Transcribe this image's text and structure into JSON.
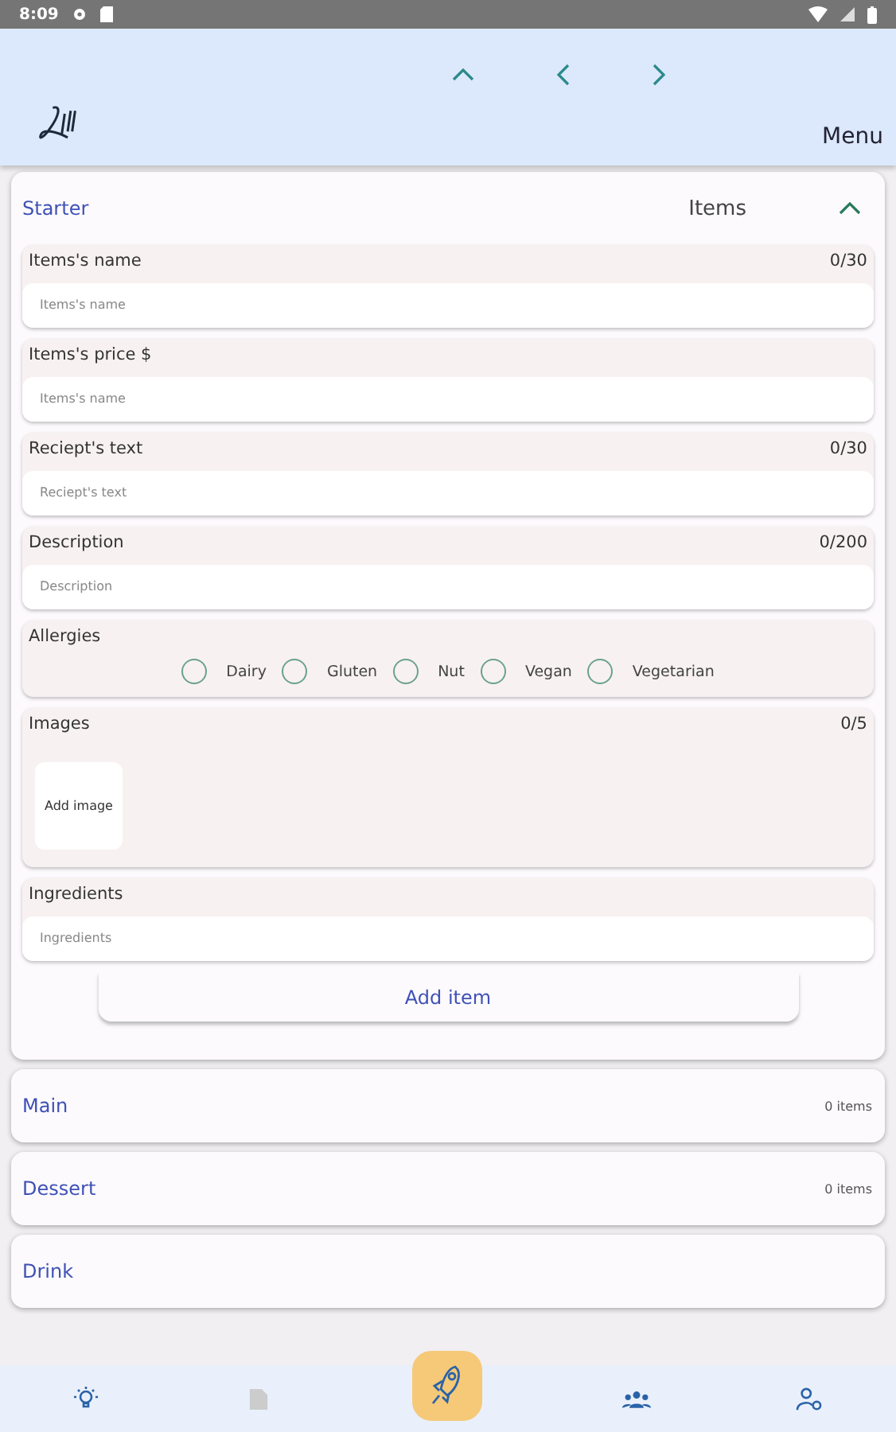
{
  "status_bar": {
    "time": "8:09"
  },
  "header": {
    "menu_label": "Menu"
  },
  "open_category": {
    "name": "Starter",
    "items_label": "Items",
    "expanded": true,
    "fields": [
      {
        "kind": "text",
        "label": "Items's name",
        "counter": "0/30",
        "placeholder": "Items's name"
      },
      {
        "kind": "text",
        "label": "Items's price $",
        "placeholder": "Items's name"
      },
      {
        "kind": "text",
        "label": "Reciept's text",
        "counter": "0/30",
        "placeholder": "Reciept's text"
      },
      {
        "kind": "text",
        "label": "Description",
        "counter": "0/200",
        "placeholder": "Description"
      },
      {
        "kind": "checks",
        "label": "Allergies",
        "options": [
          {
            "label": "Dairy",
            "checked": false
          },
          {
            "label": "Gluten",
            "checked": false
          },
          {
            "label": "Nut",
            "checked": false
          },
          {
            "label": "Vegan",
            "checked": false
          },
          {
            "label": "Vegetarian",
            "checked": false
          }
        ]
      },
      {
        "kind": "images",
        "label": "Images",
        "counter": "0/5",
        "button": "Add image"
      },
      {
        "kind": "text",
        "label": "Ingredients",
        "placeholder": "Ingredients"
      }
    ],
    "add_button": "Add item"
  },
  "categories": [
    {
      "name": "Main",
      "count": "0 items"
    },
    {
      "name": "Dessert",
      "count": "0 items"
    },
    {
      "name": "Drink"
    }
  ],
  "bottom_nav": [
    {
      "kind": "bulb",
      "selected": false,
      "disabled": false
    },
    {
      "kind": "document",
      "selected": false,
      "disabled": true
    },
    {
      "kind": "rocket",
      "selected": true,
      "disabled": false
    },
    {
      "kind": "group",
      "selected": false,
      "disabled": false
    },
    {
      "kind": "person",
      "selected": false,
      "disabled": false
    }
  ]
}
